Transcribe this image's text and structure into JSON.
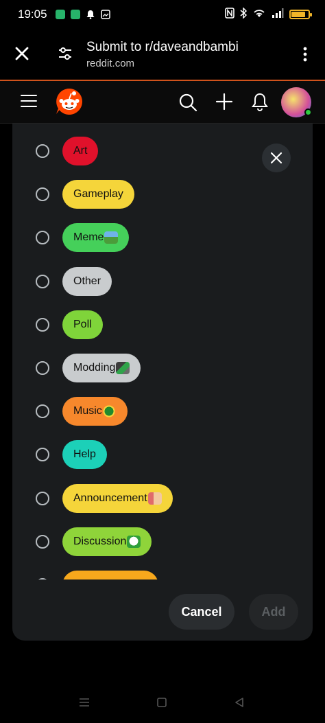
{
  "status": {
    "time": "19:05",
    "battery_level": 0.85,
    "icons": [
      "app-notification-icon",
      "app-notification-icon",
      "alarm-icon",
      "gallery-icon",
      "nfc-icon",
      "bluetooth-icon",
      "wifi-icon",
      "signal-icon",
      "battery-icon"
    ]
  },
  "browser": {
    "title": "Submit to r/daveandbambi",
    "url": "reddit.com",
    "accent_color": "#d0531c"
  },
  "reddit": {
    "brand_color": "#ff4500"
  },
  "flairs": [
    {
      "label": "Art",
      "color": "#e0112b",
      "text_color": "#111"
    },
    {
      "label": "Gameplay",
      "color": "#f5d53a",
      "text_color": "#111"
    },
    {
      "label": "Meme",
      "color": "#45d05a",
      "text_color": "#111",
      "emoji": "picture"
    },
    {
      "label": "Other",
      "color": "#c9ccce",
      "text_color": "#111"
    },
    {
      "label": "Poll",
      "color": "#7fd43a",
      "text_color": "#111"
    },
    {
      "label": "Modding",
      "color": "#c9ccce",
      "text_color": "#111",
      "emoji": "tool"
    },
    {
      "label": "Music",
      "color": "#f7882c",
      "text_color": "#111",
      "emoji": "music"
    },
    {
      "label": "Help",
      "color": "#1cd0b8",
      "text_color": "#111"
    },
    {
      "label": "Announcement",
      "color": "#f5d53a",
      "text_color": "#111",
      "emoji": "megaphone"
    },
    {
      "label": "Discussion",
      "color": "#8fd43a",
      "text_color": "#111",
      "emoji": "chat"
    },
    {
      "label": "",
      "color": "#f7a81c",
      "text_color": "#111"
    }
  ],
  "actions": {
    "cancel": "Cancel",
    "add": "Add"
  }
}
